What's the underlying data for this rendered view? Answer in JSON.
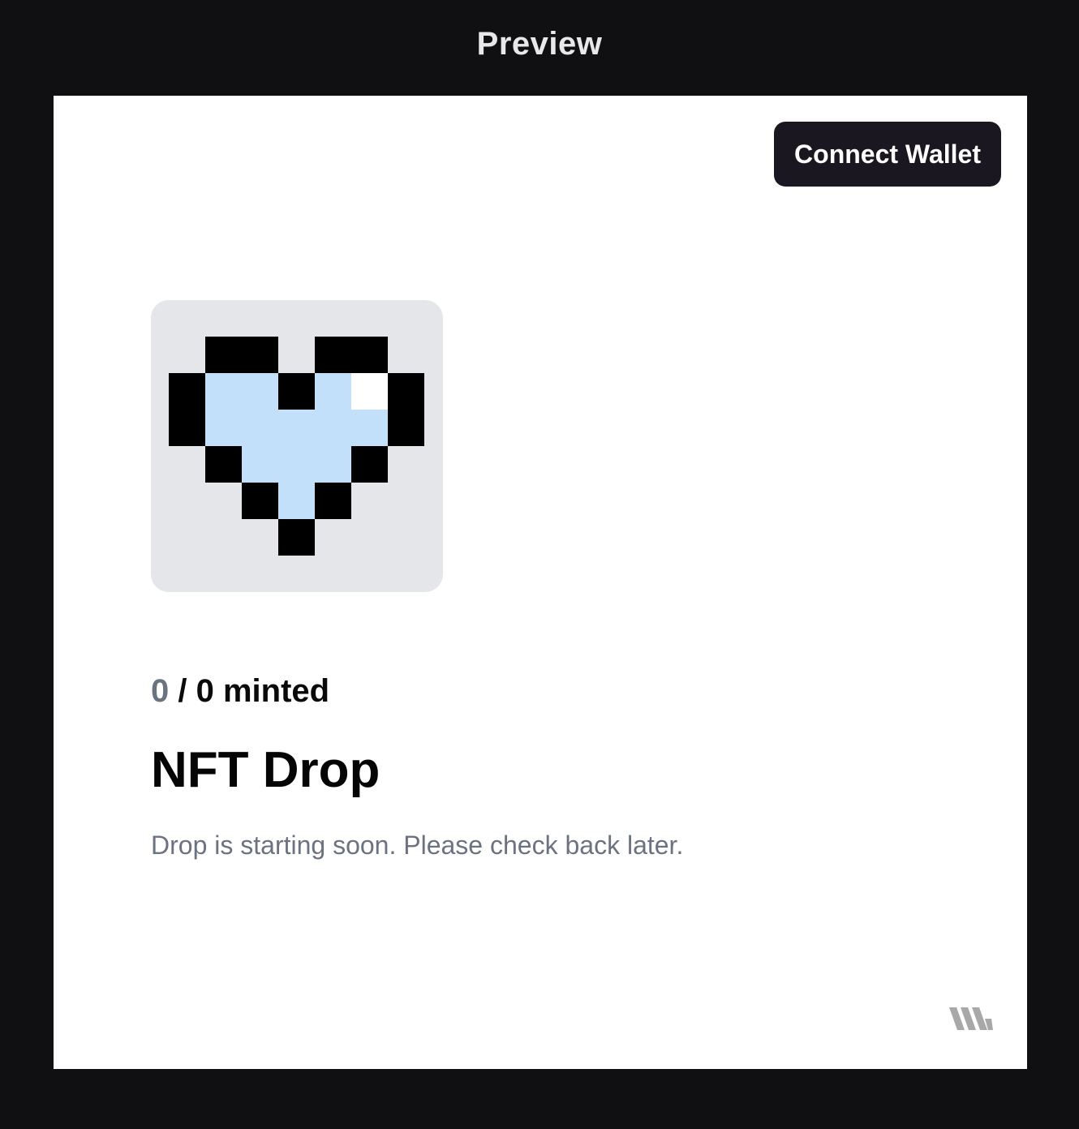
{
  "header": {
    "title": "Preview"
  },
  "drop": {
    "connect_wallet_label": "Connect Wallet",
    "minted_count": "0",
    "minted_rest": " / 0 minted",
    "title": "NFT Drop",
    "description": "Drop is starting soon. Please check back later.",
    "image_alt": "Pixel heart NFT"
  },
  "colors": {
    "page_background": "#101012",
    "frame_background": "#ffffff",
    "button_background": "#1a1721",
    "image_background": "#e5e6ea",
    "heart_fill": "#c3e0fa",
    "heart_outline": "#000000",
    "muted_text": "#6b7280",
    "logo": "#a8a8a8"
  },
  "icons": {
    "nft_image": "pixel-heart",
    "brand": "brand-logo-icon"
  }
}
